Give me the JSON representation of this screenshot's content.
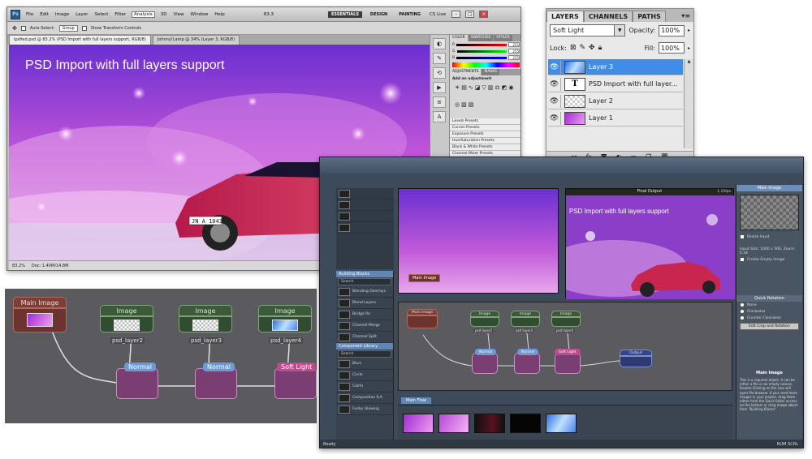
{
  "photoshop": {
    "logo": "Ps",
    "menus": [
      "File",
      "Edit",
      "Image",
      "Layer",
      "Select",
      "Filter",
      "Analysis",
      "3D",
      "View",
      "Window",
      "Help"
    ],
    "zoom": "83.3",
    "workspaces": [
      "ESSENTIALS",
      "DESIGN",
      "PAINTING"
    ],
    "cs_live": "CS Live",
    "options": {
      "auto_select": "Auto-Select:",
      "group": "Group",
      "transform": "Show Transform Controls"
    },
    "doc_tabs": [
      "Ipsfied.psd @ 83.2% (PSD Import with full layers support, RGB/8)",
      "Johnny!Lamp @ 34% (Layer 3, RGB/8)"
    ],
    "canvas_text": "PSD Import with full layers support",
    "plate": "JN A 1043",
    "status_zoom": "83.2%",
    "status_doc": "Doc: 1.40M/14.8M",
    "panel_tabs_color": [
      "COLOR",
      "SWATCHES",
      "STYLES"
    ],
    "color_values": [
      "255",
      "255",
      "255"
    ],
    "panel_tabs_adjust": [
      "ADJUSTMENTS",
      "MASKS"
    ],
    "add_adjustment": "Add an adjustment",
    "presets": [
      "Levels Presets",
      "Curves Presets",
      "Exposure Presets",
      "Hue/Saturation Presets",
      "Black & White Presets",
      "Channel Mixer Presets",
      "Selective Color Presets"
    ],
    "panel_tabs_layers": [
      "LAYERS",
      "CHANNELS",
      "PATHS"
    ],
    "mini_blend": "Normal",
    "mini_opacity_label": "Opacity:",
    "mini_opacity": "100%",
    "mini_fill_label": "Fill:",
    "mini_fill": "100%",
    "mini_lock": "Lock:",
    "mini_layers": [
      "Layer 3",
      "PSD Import with full la...",
      "Layer 2",
      "Layer 1"
    ]
  },
  "layers_panel": {
    "tabs": [
      "LAYERS",
      "CHANNELS",
      "PATHS"
    ],
    "blend_mode": "Soft Light",
    "opacity_label": "Opacity:",
    "opacity": "100%",
    "lock_label": "Lock:",
    "fill_label": "Fill:",
    "fill": "100%",
    "layers": [
      {
        "name": "Layer 3",
        "selected": true
      },
      {
        "name": "PSD Import with full layer...",
        "selected": false,
        "type_layer": true,
        "glyph": "T"
      },
      {
        "name": "Layer 2",
        "selected": false
      },
      {
        "name": "Layer 1",
        "selected": false
      }
    ],
    "footer_icons": [
      "link-icon",
      "fx-icon",
      "mask-icon",
      "adjustment-icon",
      "group-icon",
      "new-layer-icon",
      "trash-icon"
    ],
    "fx_label": "fx"
  },
  "node_graph": {
    "main_node": "Main Image",
    "image_nodes": [
      {
        "title": "Image",
        "label": "psd_layer2"
      },
      {
        "title": "Image",
        "label": "psd_layer3"
      },
      {
        "title": "Image",
        "label": "psd_layer4"
      }
    ],
    "blend_nodes": [
      "Normal",
      "Normal",
      "Soft Light"
    ]
  },
  "filter_forge": {
    "final_output": "Final Output",
    "zoom": "1.15fps",
    "preview_text": "PSD Import with full layers support",
    "main_image_label": "Main Image",
    "right_header": "Main Image",
    "resize_input": "Resize Input",
    "input_size": "Input Size: 1000 x 566, Zoom: 0.34",
    "create_empty": "Create Empty Image",
    "quick_rotation": "Quick Rotation",
    "rotation_options": [
      "None",
      "Clockwise",
      "Counter Clockwise"
    ],
    "edit_crop": "Edit Crop and Rotation",
    "main_image_title": "Main Image",
    "description": "This is a required object. It can be either a file or an empty canvas. Double-Clicking on the icon will open file browser. If you need more images in your project, drag them either from the Quick folder access on the bottom or drag image object from \"Building Blocks\"",
    "library_sections": [
      {
        "title": "Building Blocks",
        "search": "Search",
        "items": [
          "Blending Overlays",
          "Blend Layers",
          "Bridge Rn",
          "Channel Merge",
          "Channel Split",
          "Color Boost",
          "Curves",
          "Desaturate"
        ]
      },
      {
        "title": "Component Library",
        "search": "Search",
        "items": [
          "Blurs",
          "Circle",
          "Colrfx",
          "Composition fLA",
          "Funky Glowing"
        ]
      }
    ],
    "graph": {
      "main_node": "Main Image",
      "image_labels": [
        "psd layer2",
        "psd layer3",
        "psd layer4"
      ],
      "image_title": "Image",
      "blend_nodes": [
        "Normal",
        "Normal",
        "Soft Light"
      ],
      "output_node": "Output"
    },
    "flow_tab": "Main Flow",
    "status_left": "Ready",
    "status_right": "NUM SCRL"
  }
}
